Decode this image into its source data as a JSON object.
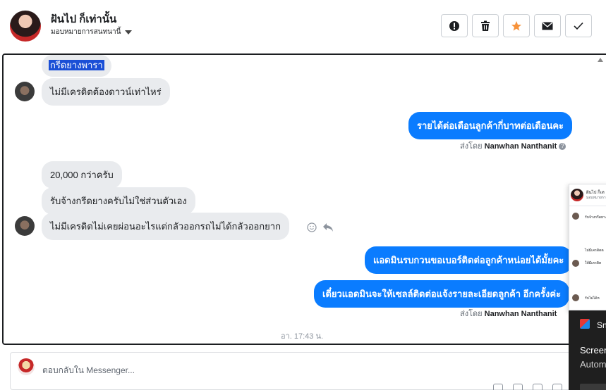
{
  "header": {
    "contact_name": "ฝันไป ก็เท่านั้น",
    "assign_label": "มอบหมายการสนทนานี้",
    "toolbar": {
      "spam_icon": "exclamation-circle",
      "delete_icon": "trash",
      "star_icon": "star",
      "mail_icon": "envelope",
      "done_icon": "check",
      "star_color": "#f7923a"
    }
  },
  "messages": {
    "m1": "กรีดยางพารา",
    "m2": "ไม่มีเครดิตต้องดาวน์เท่าไหร่",
    "m3": "รายได้ต่อเดือนลูกค้ากี่บาทต่อเดือนคะ",
    "m3_sent_by_prefix": "ส่งโดย",
    "m3_sent_by_name": "Nanwhan Nanthanit",
    "m4": "20,000 กว่าครับ",
    "m5": "รับจ้างกรีดยางครับไม่ใช่ส่วนตัวเอง",
    "m6": "ไม่มีเครดิตไม่เคยผ่อนอะไรแต่กลัวออกรถไม่ได้กลัวออกยาก",
    "m7": "แอดมินรบกวนขอเบอร์ติดต่อลูกค้าหน่อยได้มั้ยคะ",
    "m8": "เดี๋ยวแอดมินจะให้เซลล์ติดต่อแจ้งรายละเอียดลูกค้า อีกครั้งค่ะ",
    "m8_sent_by_prefix": "ส่งโดย",
    "m8_sent_by_name": "Nanwhan Nanthanit",
    "timestamp": "อา. 17:43 น."
  },
  "reply": {
    "placeholder": "ตอบกลับใน Messenger..."
  },
  "popup": {
    "name": "ฝันไป ก็เท",
    "sub": "มอบหมายการ",
    "msg1": "รับจ้างกรีดยาง",
    "msg2": "ไม่มีเครดิตต",
    "msg3": "ให้มีเครดิต",
    "msg4": "รับไม่ได้ห"
  },
  "notification": {
    "app": "Sn",
    "title": "Screen",
    "body": "Autom"
  },
  "colors": {
    "outgoing_bubble": "#0a7cff",
    "incoming_bubble": "#e9ebee"
  }
}
